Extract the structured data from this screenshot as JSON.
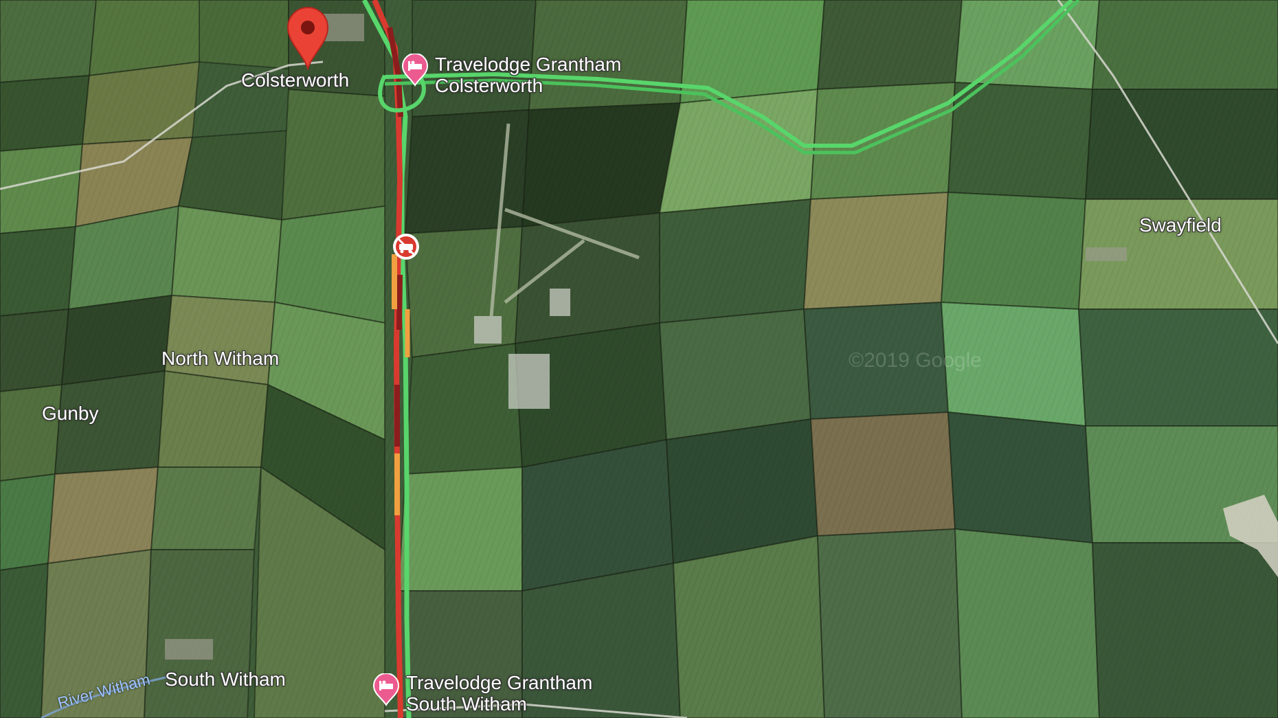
{
  "map": {
    "view": "satellite",
    "places": {
      "colsterworth": "Colsterworth",
      "north_witham": "North Witham",
      "gunby": "Gunby",
      "swayfield": "Swayfield",
      "south_witham": "South Witham"
    },
    "river": "River Witham",
    "watermark": "©2019 Google",
    "pois": [
      {
        "line1": "Travelodge Grantham",
        "line2": "Colsterworth",
        "icon": "hotel-icon"
      },
      {
        "line1": "Travelodge Grantham",
        "line2": "South Witham",
        "icon": "hotel-icon"
      }
    ],
    "markers": {
      "location_pin": "location-pin-icon",
      "incident": "road-closure-icon"
    },
    "colors": {
      "traffic_heavy": "#d93a2f",
      "traffic_severe": "#8b1d1d",
      "traffic_slow": "#f0a040",
      "traffic_clear": "#58d66b",
      "pin": "#ea4335",
      "poi": "#ec5b8f"
    }
  }
}
